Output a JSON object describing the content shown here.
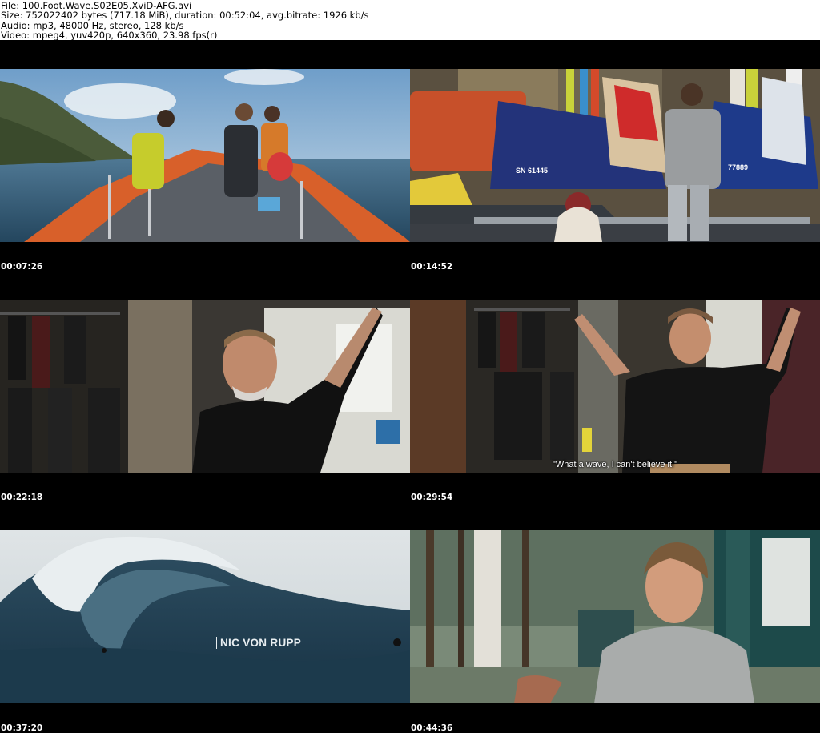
{
  "header": {
    "file": "File: 100.Foot.Wave.S02E05.XviD-AFG.avi",
    "size": "Size: 752022402 bytes (717.18 MiB), duration: 00:52:04, avg.bitrate: 1926 kb/s",
    "audio": "Audio: mp3, 48000 Hz, stereo, 128 kb/s",
    "video": "Video: mpeg4, yuv420p, 640x360, 23.98 fps(r)"
  },
  "frames": [
    {
      "timestamp": "00:07:26"
    },
    {
      "timestamp": "00:14:52",
      "reg_a": "SN 61445",
      "reg_b": "77889"
    },
    {
      "timestamp": "00:22:18"
    },
    {
      "timestamp": "00:29:54",
      "subtitle": "\"What a wave, I can't believe it!\""
    },
    {
      "timestamp": "00:37:20",
      "caption": "NIC VON RUPP"
    },
    {
      "timestamp": "00:44:36"
    }
  ]
}
